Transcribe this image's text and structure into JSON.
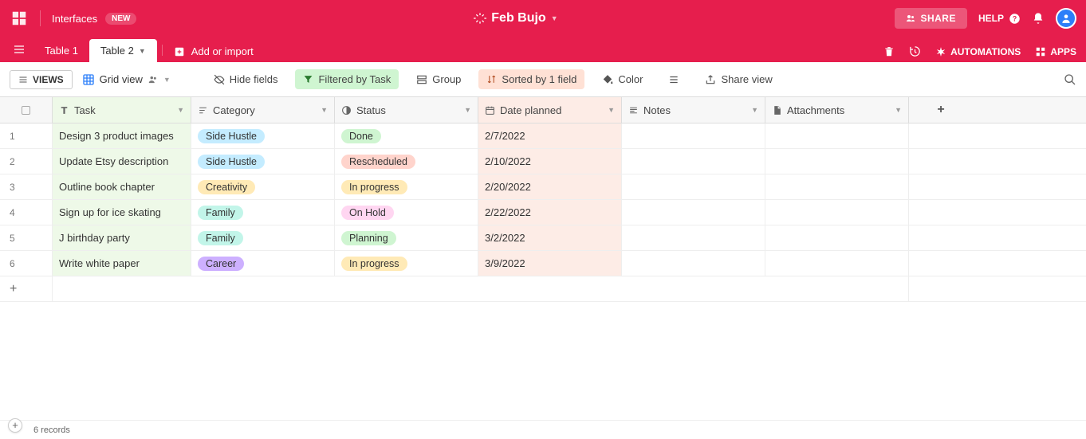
{
  "topbar": {
    "interfaces": "Interfaces",
    "new_badge": "NEW",
    "base_name": "Feb Bujo",
    "share": "SHARE",
    "help": "HELP"
  },
  "tabs": {
    "items": [
      {
        "label": "Table 1",
        "active": false
      },
      {
        "label": "Table 2",
        "active": true
      }
    ],
    "add_import": "Add or import",
    "automations": "AUTOMATIONS",
    "apps": "APPS"
  },
  "toolbar": {
    "views": "VIEWS",
    "grid_view": "Grid view",
    "hide_fields": "Hide fields",
    "filtered": "Filtered by Task",
    "group": "Group",
    "sorted": "Sorted by 1 field",
    "color": "Color",
    "share_view": "Share view"
  },
  "columns": {
    "task": "Task",
    "category": "Category",
    "status": "Status",
    "date": "Date planned",
    "notes": "Notes",
    "attachments": "Attachments"
  },
  "rows": [
    {
      "n": "1",
      "task": "Design 3 product images",
      "category": "Side Hustle",
      "cat_cls": "p-sidehustle",
      "status": "Done",
      "st_cls": "p-done",
      "date": "2/7/2022"
    },
    {
      "n": "2",
      "task": "Update Etsy description",
      "category": "Side Hustle",
      "cat_cls": "p-sidehustle",
      "status": "Rescheduled",
      "st_cls": "p-rescheduled",
      "date": "2/10/2022"
    },
    {
      "n": "3",
      "task": "Outline book chapter",
      "category": "Creativity",
      "cat_cls": "p-creativity",
      "status": "In progress",
      "st_cls": "p-inprogress",
      "date": "2/20/2022"
    },
    {
      "n": "4",
      "task": "Sign up for ice skating",
      "category": "Family",
      "cat_cls": "p-family",
      "status": "On Hold",
      "st_cls": "p-onhold",
      "date": "2/22/2022"
    },
    {
      "n": "5",
      "task": "J birthday party",
      "category": "Family",
      "cat_cls": "p-family",
      "status": "Planning",
      "st_cls": "p-planning",
      "date": "3/2/2022"
    },
    {
      "n": "6",
      "task": "Write white paper",
      "category": "Career",
      "cat_cls": "p-career",
      "status": "In progress",
      "st_cls": "p-inprogress",
      "date": "3/9/2022"
    }
  ],
  "footer": {
    "record_count": "6 records"
  }
}
